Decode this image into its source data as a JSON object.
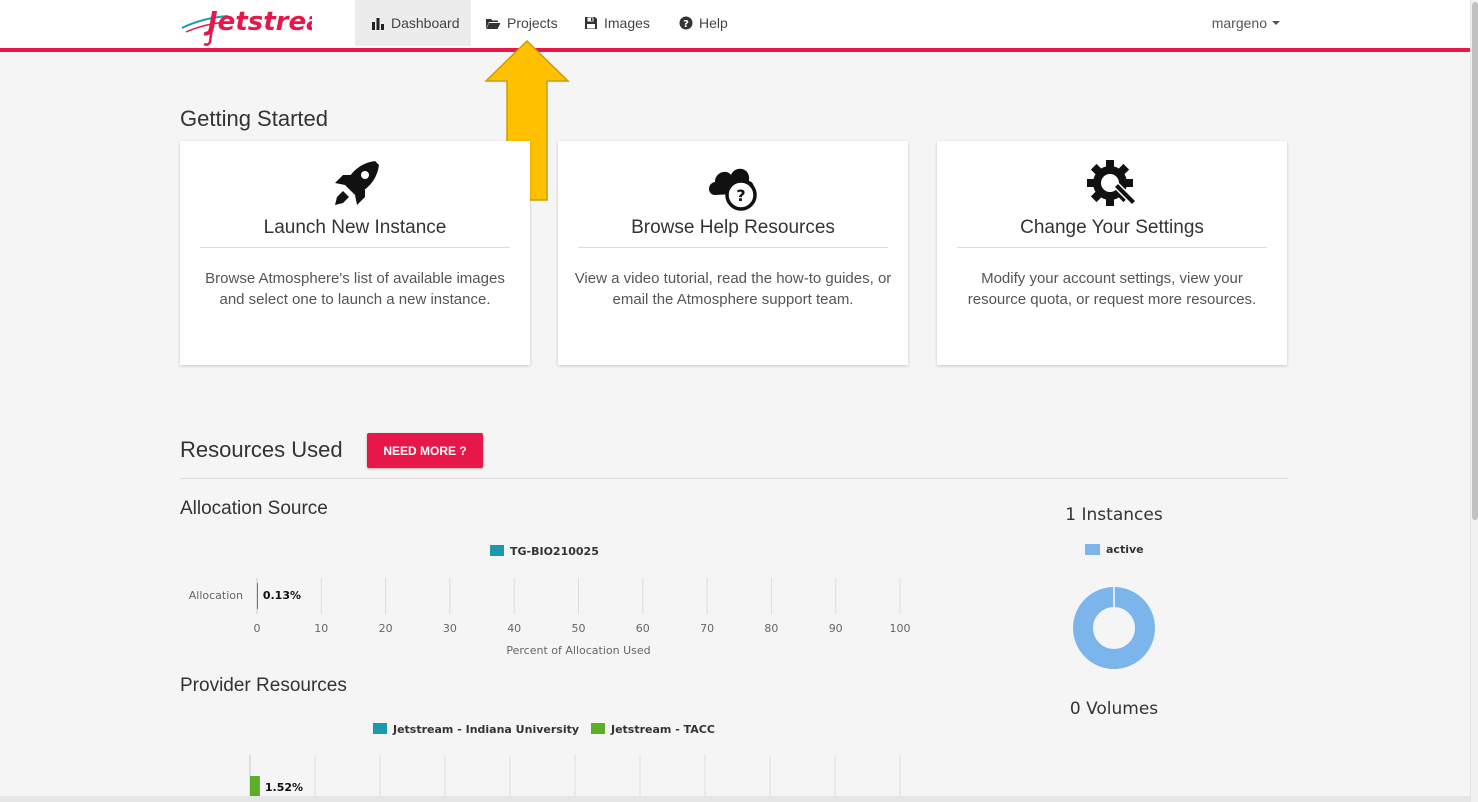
{
  "app": {
    "name": "Jetstream"
  },
  "nav": {
    "items": [
      {
        "label": "Dashboard",
        "icon": "bar-chart-icon",
        "active": true
      },
      {
        "label": "Projects",
        "icon": "folder-open-icon",
        "active": false
      },
      {
        "label": "Images",
        "icon": "floppy-disk-icon",
        "active": false
      },
      {
        "label": "Help",
        "icon": "question-circle-icon",
        "active": false
      }
    ],
    "user": "margeno"
  },
  "getting_started": {
    "title": "Getting Started",
    "cards": [
      {
        "title": "Launch New Instance",
        "icon": "rocket-icon",
        "description": "Browse Atmosphere's list of available images and select one to launch a new instance."
      },
      {
        "title": "Browse Help Resources",
        "icon": "cloud-help-icon",
        "description": "View a video tutorial, read the how-to guides, or email the Atmosphere support team."
      },
      {
        "title": "Change Your Settings",
        "icon": "gear-wrench-icon",
        "description": "Modify your account settings, view your resource quota, or request more resources."
      }
    ]
  },
  "resources": {
    "title": "Resources Used",
    "need_more_label": "NEED MORE ?",
    "allocation_title": "Allocation Source",
    "provider_title": "Provider Resources",
    "instances_title": "1 Instances",
    "volumes_title": "0 Volumes",
    "instances_legend": "active"
  },
  "colors": {
    "accent": "#e8174a",
    "teal": "#1a9aaa",
    "green": "#5aae28",
    "donut": "#7cb5ec"
  },
  "chart_data": [
    {
      "type": "bar",
      "orientation": "horizontal",
      "categories": [
        "Allocation"
      ],
      "series": [
        {
          "name": "TG-BIO210025",
          "values": [
            0.13
          ],
          "color": "#1a9aaa"
        }
      ],
      "data_labels": [
        "0.13%"
      ],
      "xlabel": "Percent of Allocation Used",
      "xlim": [
        0,
        100
      ],
      "xticks": [
        0,
        10,
        20,
        30,
        40,
        50,
        60,
        70,
        80,
        90,
        100
      ],
      "legend": "top"
    },
    {
      "type": "bar",
      "orientation": "horizontal",
      "categories": [
        ""
      ],
      "series": [
        {
          "name": "Jetstream - Indiana University",
          "values": [
            0
          ],
          "color": "#1a9aaa"
        },
        {
          "name": "Jetstream - TACC",
          "values": [
            1.52
          ],
          "color": "#5aae28"
        }
      ],
      "data_labels": [
        "1.52%"
      ],
      "xlim": [
        0,
        100
      ],
      "legend": "top"
    },
    {
      "type": "pie",
      "series": [
        {
          "name": "active",
          "values": [
            1
          ],
          "color": "#7cb5ec"
        }
      ],
      "legend": "top"
    }
  ]
}
